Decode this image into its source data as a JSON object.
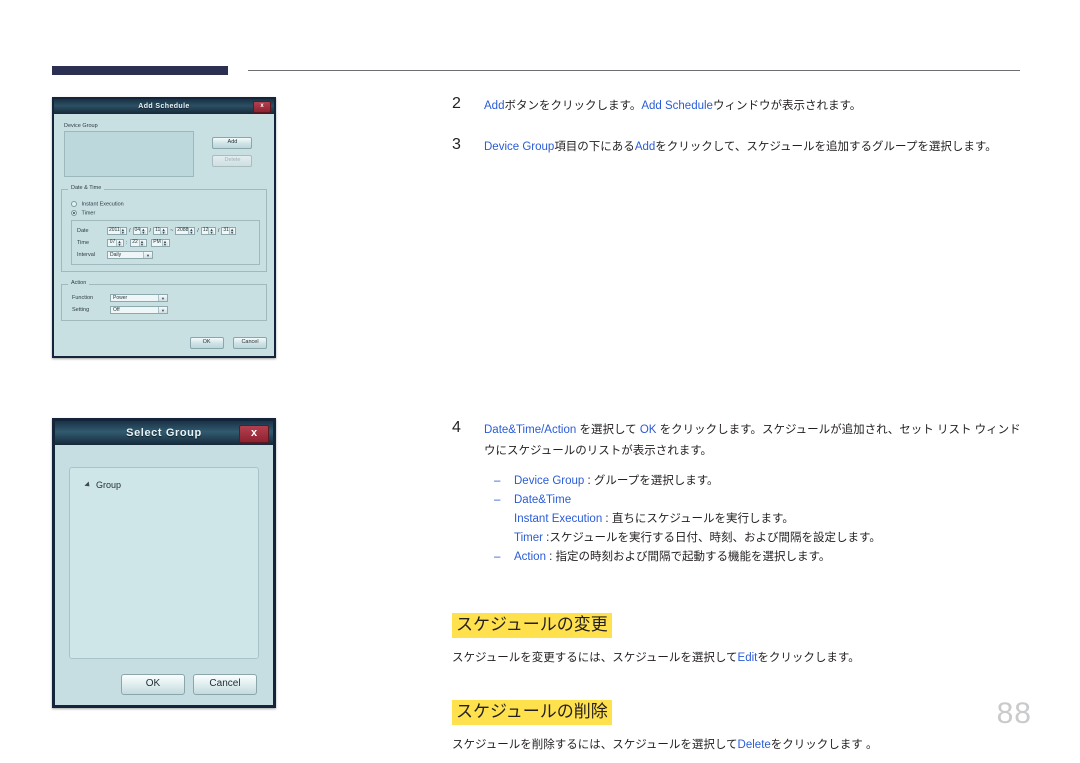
{
  "page": {
    "number": "88",
    "accent_blue": "#2a5cd7",
    "highlight_yellow": "#ffe14d",
    "header_bar_color": "#2b3053"
  },
  "steps": [
    {
      "num": "2",
      "parts": [
        {
          "t": "Add",
          "blue": true
        },
        {
          "t": "ボタンをクリックします。",
          "blue": false
        },
        {
          "t": "Add Schedule",
          "blue": true
        },
        {
          "t": "ウィンドウが表示されます。",
          "blue": false
        }
      ]
    },
    {
      "num": "3",
      "parts": [
        {
          "t": "Device Group",
          "blue": true
        },
        {
          "t": "項目の下にある",
          "blue": false
        },
        {
          "t": "Add",
          "blue": true
        },
        {
          "t": "をクリックして、スケジュールを追加するグループを選択します。",
          "blue": false
        }
      ]
    },
    {
      "num": "4",
      "parts": [
        {
          "t": "Date&Time/Action ",
          "blue": true
        },
        {
          "t": "を選択して ",
          "blue": false
        },
        {
          "t": "OK",
          "blue": true
        },
        {
          "t": " をクリックします。スケジュールが追加され、セット リスト ウィンドウにスケジュールのリストが表示されます。",
          "blue": false
        }
      ],
      "sub": [
        {
          "dash": true,
          "parts": [
            {
              "t": "Device Group",
              "blue": true
            },
            {
              "t": " : グループを選択します。",
              "blue": false
            }
          ]
        },
        {
          "dash": true,
          "parts": [
            {
              "t": "Date&Time",
              "blue": true
            }
          ]
        },
        {
          "dash": false,
          "parts": [
            {
              "t": "Instant Execution",
              "blue": true
            },
            {
              "t": " : 直ちにスケジュールを実行します。",
              "blue": false
            }
          ]
        },
        {
          "dash": false,
          "parts": [
            {
              "t": "Timer",
              "blue": true
            },
            {
              "t": " :スケジュールを実行する日付、時刻、および間隔を設定します。",
              "blue": false
            }
          ]
        },
        {
          "dash": true,
          "parts": [
            {
              "t": "Action",
              "blue": true
            },
            {
              "t": " : 指定の時刻および間隔で起動する機能を選択します。",
              "blue": false
            }
          ]
        }
      ]
    }
  ],
  "sections": [
    {
      "heading": "スケジュールの変更",
      "body_parts": [
        {
          "t": "スケジュールを変更するには、スケジュールを選択して",
          "blue": false
        },
        {
          "t": "Edit",
          "blue": true
        },
        {
          "t": "をクリックします。",
          "blue": false
        }
      ]
    },
    {
      "heading": "スケジュールの削除",
      "body_parts": [
        {
          "t": "スケジュールを削除するには、スケジュールを選択して",
          "blue": false
        },
        {
          "t": "Delete",
          "blue": true
        },
        {
          "t": "をクリックします 。",
          "blue": false
        }
      ]
    }
  ],
  "add_schedule_dialog": {
    "title": "Add Schedule",
    "close_label": "x",
    "device_group": {
      "label": "Device Group",
      "add_button": "Add",
      "delete_button": "Delete"
    },
    "date_time": {
      "group_label": "Date & Time",
      "instant_execution": "Instant Execution",
      "timer": "Timer",
      "date_label": "Date",
      "date_from": {
        "year": "2011",
        "month": "04",
        "day": "11"
      },
      "date_to": {
        "year": "2088",
        "month": "12",
        "day": "31"
      },
      "range_sep": "~",
      "time_label": "Time",
      "time": {
        "hour": "07",
        "minute": "22",
        "ampm": "PM"
      },
      "interval_label": "Interval",
      "interval_value": "Daily"
    },
    "action": {
      "group_label": "Action",
      "function_label": "Function",
      "function_value": "Power",
      "setting_label": "Setting",
      "setting_value": "Off"
    },
    "ok_button": "OK",
    "cancel_button": "Cancel"
  },
  "select_group_dialog": {
    "title": "Select Group",
    "close_label": "x",
    "tree_item": "Group",
    "ok_button": "OK",
    "cancel_button": "Cancel"
  }
}
